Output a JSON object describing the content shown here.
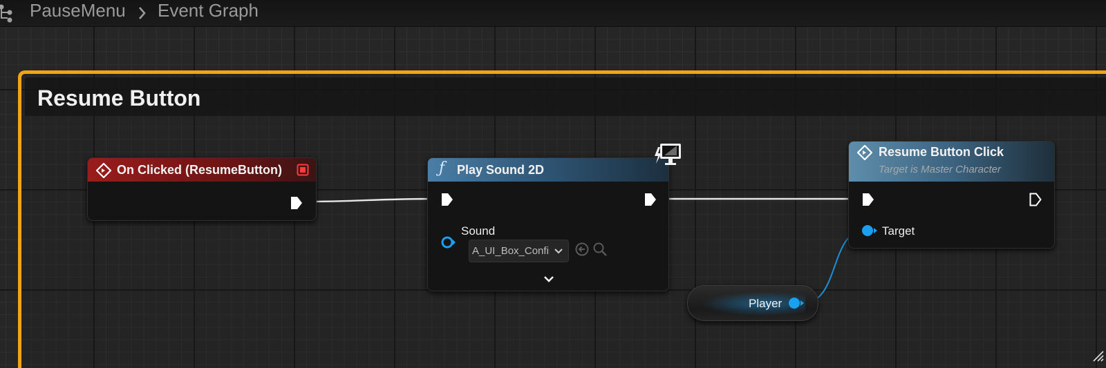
{
  "breadcrumb": {
    "blueprint": "PauseMenu",
    "separator": ">",
    "graph": "Event Graph",
    "icon": "graph-tree-icon"
  },
  "comment": {
    "title": "Resume Button",
    "color": "#f2a413"
  },
  "nodes": {
    "on_clicked": {
      "title": "On Clicked (ResumeButton)",
      "header_color": "#8e1a1a",
      "icon": "event-diamond-icon",
      "delegate_icon": "delegate-square-icon"
    },
    "play_sound": {
      "title": "Play Sound 2D",
      "header_color": "#3d6a8c",
      "icon": "function-icon",
      "badge_icon": "client-only-monitor-icon",
      "sound_pin_label": "Sound",
      "sound_value": "A_UI_Box_Confirm",
      "use_asset_icon": "use-selected-asset-icon",
      "browse_icon": "browse-asset-search-icon",
      "expand_icon": "chevron-down-icon"
    },
    "resume_click": {
      "title": "Resume Button Click",
      "subtitle": "Target is Master Character",
      "header_color": "#4c7894",
      "icon": "event-diamond-icon",
      "target_pin_label": "Target"
    },
    "player": {
      "label": "Player",
      "pin_color": "#1aa0f0"
    }
  },
  "colors": {
    "exec_wire": "#e6e6e6",
    "object_wire": "#1a8fd6"
  }
}
